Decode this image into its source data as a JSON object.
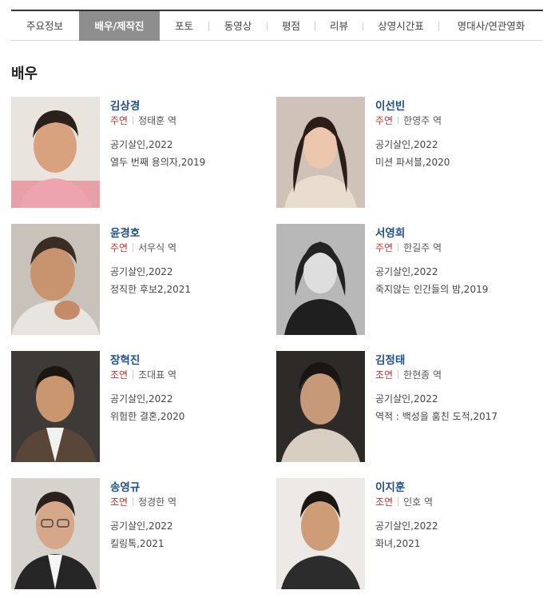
{
  "tabs": [
    {
      "label": "주요정보"
    },
    {
      "label": "배우/제작진"
    },
    {
      "label": "포토"
    },
    {
      "label": "동영상"
    },
    {
      "label": "평점"
    },
    {
      "label": "리뷰"
    },
    {
      "label": "상영시간표"
    },
    {
      "label": "명대사/연관영화"
    }
  ],
  "section_title": "배우",
  "actors": [
    {
      "name": "김상경",
      "role_type": "주연",
      "character": "정태훈 역",
      "films": [
        "공기살인,2022",
        "열두 번째 용의자,2019"
      ]
    },
    {
      "name": "이선빈",
      "role_type": "주연",
      "character": "한영주 역",
      "films": [
        "공기살인,2022",
        "미션 파서블,2020"
      ]
    },
    {
      "name": "윤경호",
      "role_type": "주연",
      "character": "서우식 역",
      "films": [
        "공기살인,2022",
        "정직한 후보2,2021"
      ]
    },
    {
      "name": "서영희",
      "role_type": "주연",
      "character": "한길주 역",
      "films": [
        "공기살인,2022",
        "죽지않는 인간들의 밤,2019"
      ]
    },
    {
      "name": "장혁진",
      "role_type": "조연",
      "character": "조대표 역",
      "films": [
        "공기살인,2022",
        "위험한 결혼,2020"
      ]
    },
    {
      "name": "김정태",
      "role_type": "조연",
      "character": "한현종 역",
      "films": [
        "공기살인,2022",
        "역적 : 백성을 훔친 도적,2017"
      ]
    },
    {
      "name": "송영규",
      "role_type": "조연",
      "character": "정경한 역",
      "films": [
        "공기살인,2022",
        "킬링톡,2021"
      ]
    },
    {
      "name": "이지훈",
      "role_type": "조연",
      "character": "인호 역",
      "films": [
        "공기살인,2022",
        "화녀,2021"
      ]
    }
  ]
}
